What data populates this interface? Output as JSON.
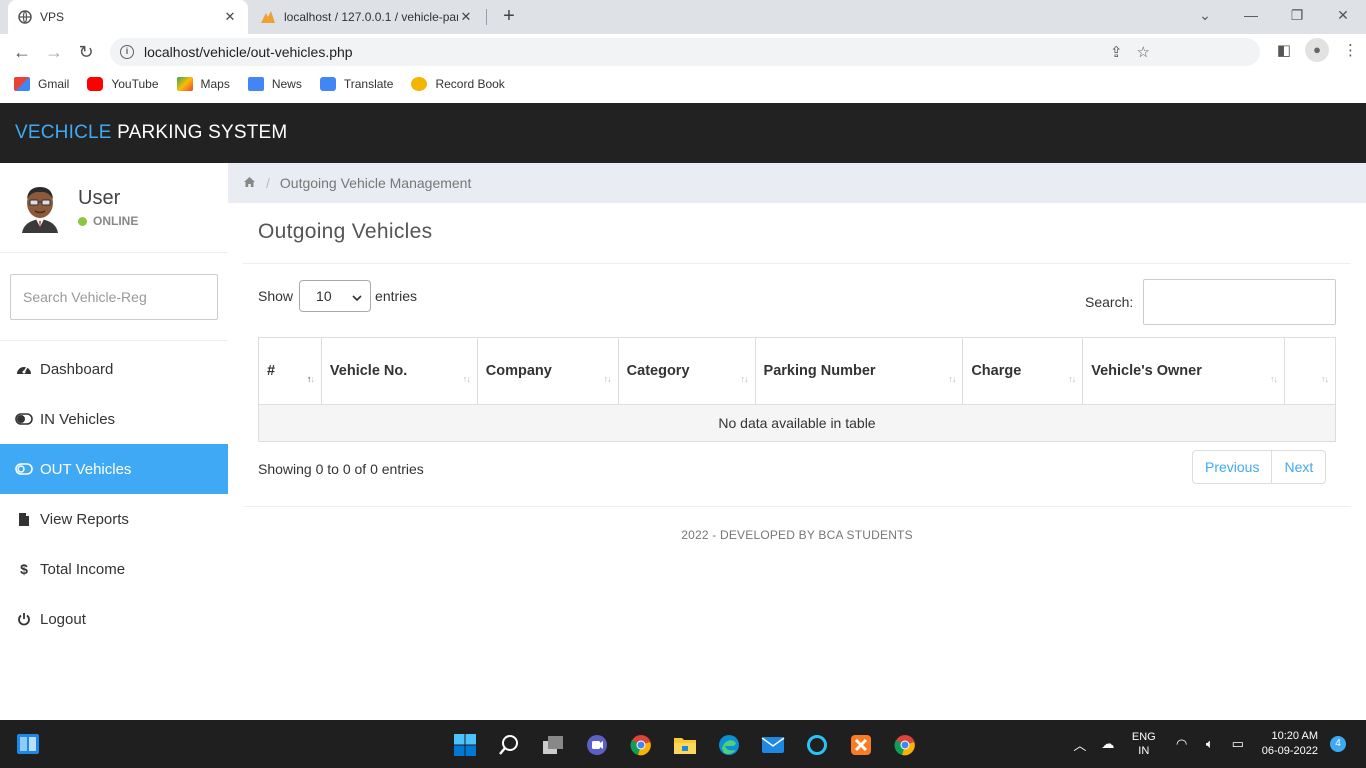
{
  "browser": {
    "tabs": [
      {
        "title": "VPS",
        "active": true
      },
      {
        "title": "localhost / 127.0.0.1 / vehicle-par",
        "active": false
      }
    ],
    "url": "localhost/vehicle/out-vehicles.php",
    "bookmarks": [
      {
        "label": "Gmail",
        "icon": "gmail-icon",
        "color": "#ea4335"
      },
      {
        "label": "YouTube",
        "icon": "youtube-icon",
        "color": "#ff0000"
      },
      {
        "label": "Maps",
        "icon": "maps-icon",
        "color": "#34a853"
      },
      {
        "label": "News",
        "icon": "news-icon",
        "color": "#4285f4"
      },
      {
        "label": "Translate",
        "icon": "translate-icon",
        "color": "#4285f4"
      },
      {
        "label": "Record Book",
        "icon": "record-book-icon",
        "color": "#f4b400"
      }
    ]
  },
  "app": {
    "brand_part1": "VECHICLE",
    "brand_part2": "PARKING SYSTEM",
    "accent": "#3fa9f5",
    "header_bg": "#222222"
  },
  "sidebar": {
    "user_name": "User",
    "status": "ONLINE",
    "search_placeholder": "Search Vehicle-Reg",
    "items": [
      {
        "label": "Dashboard",
        "icon": "dashboard-icon",
        "active": false
      },
      {
        "label": "IN Vehicles",
        "icon": "toggle-on-icon",
        "active": false
      },
      {
        "label": "OUT Vehicles",
        "icon": "toggle-off-icon",
        "active": true
      },
      {
        "label": "View Reports",
        "icon": "file-icon",
        "active": false
      },
      {
        "label": "Total Income",
        "icon": "dollar-icon",
        "active": false
      },
      {
        "label": "Logout",
        "icon": "power-icon",
        "active": false
      }
    ]
  },
  "main": {
    "breadcrumb": "Outgoing Vehicle Management",
    "title": "Outgoing Vehicles",
    "show_label": "Show",
    "entries_value": "10",
    "entries_label": "entries",
    "search_label": "Search:",
    "columns": [
      "#",
      "Vehicle No.",
      "Company",
      "Category",
      "Parking Number",
      "Charge",
      "Vehicle's Owner",
      ""
    ],
    "empty_text": "No data available in table",
    "showing_text": "Showing 0 to 0 of 0 entries",
    "prev_label": "Previous",
    "next_label": "Next",
    "footer": "2022 - DEVELOPED BY BCA STUDENTS"
  },
  "taskbar": {
    "lang_line1": "ENG",
    "lang_line2": "IN",
    "time": "10:20 AM",
    "date": "06-09-2022",
    "notification_count": "4"
  }
}
